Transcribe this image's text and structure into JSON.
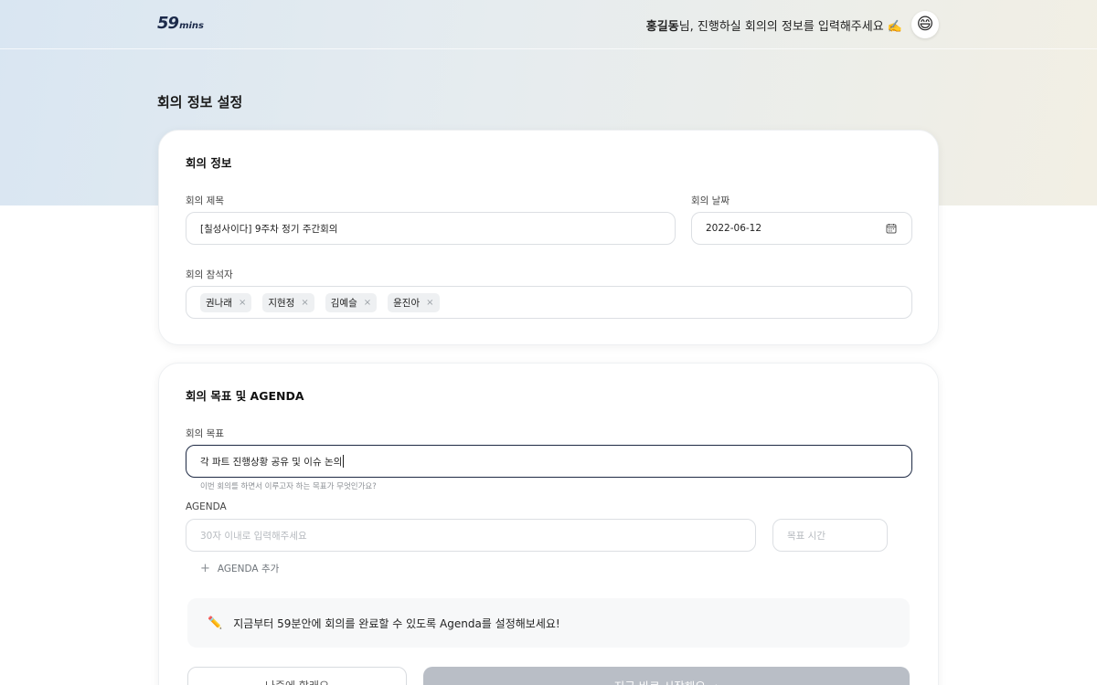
{
  "header": {
    "logo_num": "59",
    "logo_mins": "mins",
    "user_name": "홍길동",
    "greeting_suffix": "님, 진행하실 회의의 정보를 입력해주세요 ✍️",
    "avatar_emoji": "😄"
  },
  "page": {
    "title": "회의 정보 설정"
  },
  "meeting_info": {
    "section_title": "회의 정보",
    "title_label": "회의 제목",
    "title_value": "[칠성사이다] 9주차 정기 주간회의",
    "date_label": "회의 날짜",
    "date_value": "2022-06-12",
    "attendees_label": "회의 참석자",
    "attendees": [
      "권나래",
      "지현정",
      "김예슬",
      "윤진아"
    ],
    "chip_remove": "×"
  },
  "goal_agenda": {
    "section_title": "회의 목표 및 AGENDA",
    "goal_label": "회의 목표",
    "goal_value": "각 파트 진행상황 공유 및 이슈 논의",
    "goal_hint": "이번 회의를 하면서 이루고자 하는 목표가 무엇인가요?",
    "agenda_label": "AGENDA",
    "agenda_placeholder": "30자 이내로 입력해주세요",
    "time_placeholder": "목표 시간",
    "add_agenda_label": "AGENDA 추가",
    "notice_icon": "✏️",
    "notice_text": "지금부터 59분안에 회의를 완료할 수 있도록 Agenda를 설정해보세요!",
    "later_button": "나중에 할래요",
    "start_button": "지금 바로 시작해요 →"
  },
  "colors": {
    "accent_dark": "#1e2a44",
    "button_disabled": "#b9bec6"
  }
}
